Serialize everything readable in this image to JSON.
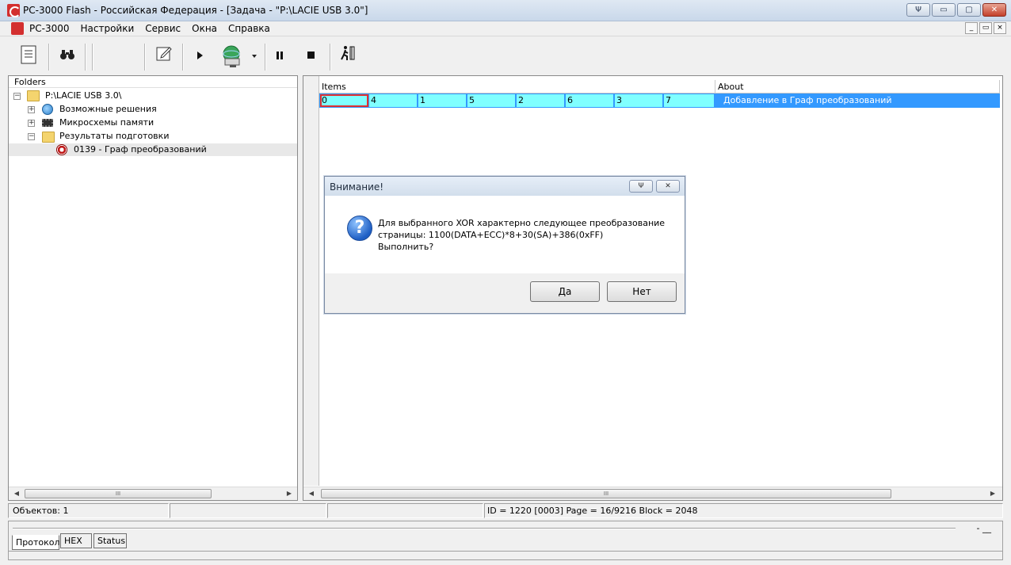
{
  "window": {
    "title": "PC-3000 Flash  - Российская Федерация - [Задача - \"P:\\LACIE USB 3.0\"]",
    "buttons": [
      "Ψ",
      "▭",
      "▢",
      "✕"
    ]
  },
  "menu": {
    "items": [
      "PC-3000",
      "Настройки",
      "Сервис",
      "Окна",
      "Справка"
    ],
    "mdi_buttons": [
      "_",
      "▭",
      "×"
    ]
  },
  "toolbar": {
    "icons": [
      "log-icon",
      "binoculars-icon",
      "edit-icon",
      "play-icon",
      "network-icon",
      "pause-icon",
      "stop-icon",
      "exit-icon"
    ]
  },
  "folders": {
    "header": "Folders",
    "root": "P:\\LACIE USB 3.0\\",
    "items": [
      {
        "label": "Возможные решения",
        "icon": "globe-icon",
        "expander": "+"
      },
      {
        "label": "Микросхемы памяти",
        "icon": "chip-icon",
        "expander": "+"
      },
      {
        "label": "Результаты подготовки",
        "icon": "folder-icon",
        "expander": "−"
      },
      {
        "label": "0139 - Граф преобразований",
        "icon": "graph-icon",
        "expander": ""
      }
    ],
    "scroll_grip": "III"
  },
  "table": {
    "columns": [
      "Items",
      "About"
    ],
    "row": {
      "cells": [
        "0",
        "4",
        "1",
        "5",
        "2",
        "6",
        "3",
        "7"
      ],
      "about": "Добавление в Граф преобразований"
    },
    "scroll_grip": "III"
  },
  "dialog": {
    "title": "Внимание!",
    "message_lines": [
      "Для выбранного XOR характерно следующее преобразование",
      "страницы: 1100(DATA+ECC)*8+30(SA)+386(0xFF)",
      "Выполнить?"
    ],
    "yes": "Да",
    "no": "Нет"
  },
  "status": {
    "objects": "Объектов: 1",
    "info": "ID = 1220 [0003] Page  = 16/9216 Block = 2048"
  },
  "log": {
    "tabs": [
      "Протокол",
      "HEX",
      "Status"
    ],
    "active_tab": "Протокол",
    "controls": "-  __"
  }
}
